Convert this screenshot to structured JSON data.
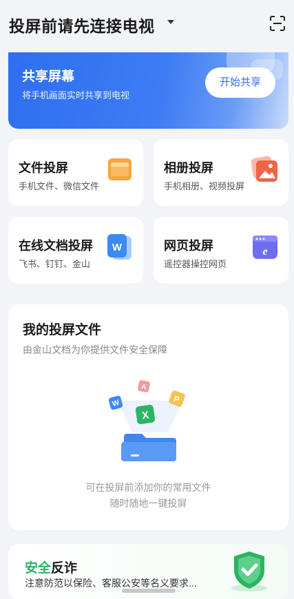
{
  "header": {
    "title": "投屏前请先连接电视",
    "dropdown_icon": "caret-down-icon",
    "scan_icon": "scan-icon"
  },
  "banner": {
    "title": "共享屏幕",
    "subtitle": "将手机画面实时共享到电视",
    "button_label": "开始共享",
    "accent": "#2f6ff0"
  },
  "cards": [
    {
      "title": "文件投屏",
      "subtitle": "手机文件、微信文件",
      "icon": "folder-icon",
      "color": "#f6a63c"
    },
    {
      "title": "相册投屏",
      "subtitle": "手机相册、视频投屏",
      "icon": "photo-icon",
      "color": "#f06446"
    },
    {
      "title": "在线文档投屏",
      "subtitle": "飞书、钉钉、金山",
      "icon": "word-doc-icon",
      "color": "#3b8af5"
    },
    {
      "title": "网页投屏",
      "subtitle": "遥控器操控网页",
      "icon": "browser-icon",
      "color": "#6f6cf2"
    }
  ],
  "my_files": {
    "title": "我的投屏文件",
    "subtitle": "由金山文档为你提供文件安全保障",
    "empty_line1": "可在投屏前添加你的常用文件",
    "empty_line2": "随时随地一键投屏",
    "illustration_letters": [
      "W",
      "A",
      "P",
      "X"
    ]
  },
  "safety": {
    "title_green": "安全",
    "title_black": "反诈",
    "subtitle": "注意防范以保险、客服公安等名义要求...",
    "icon": "shield-check-icon",
    "color": "#2cb463"
  }
}
